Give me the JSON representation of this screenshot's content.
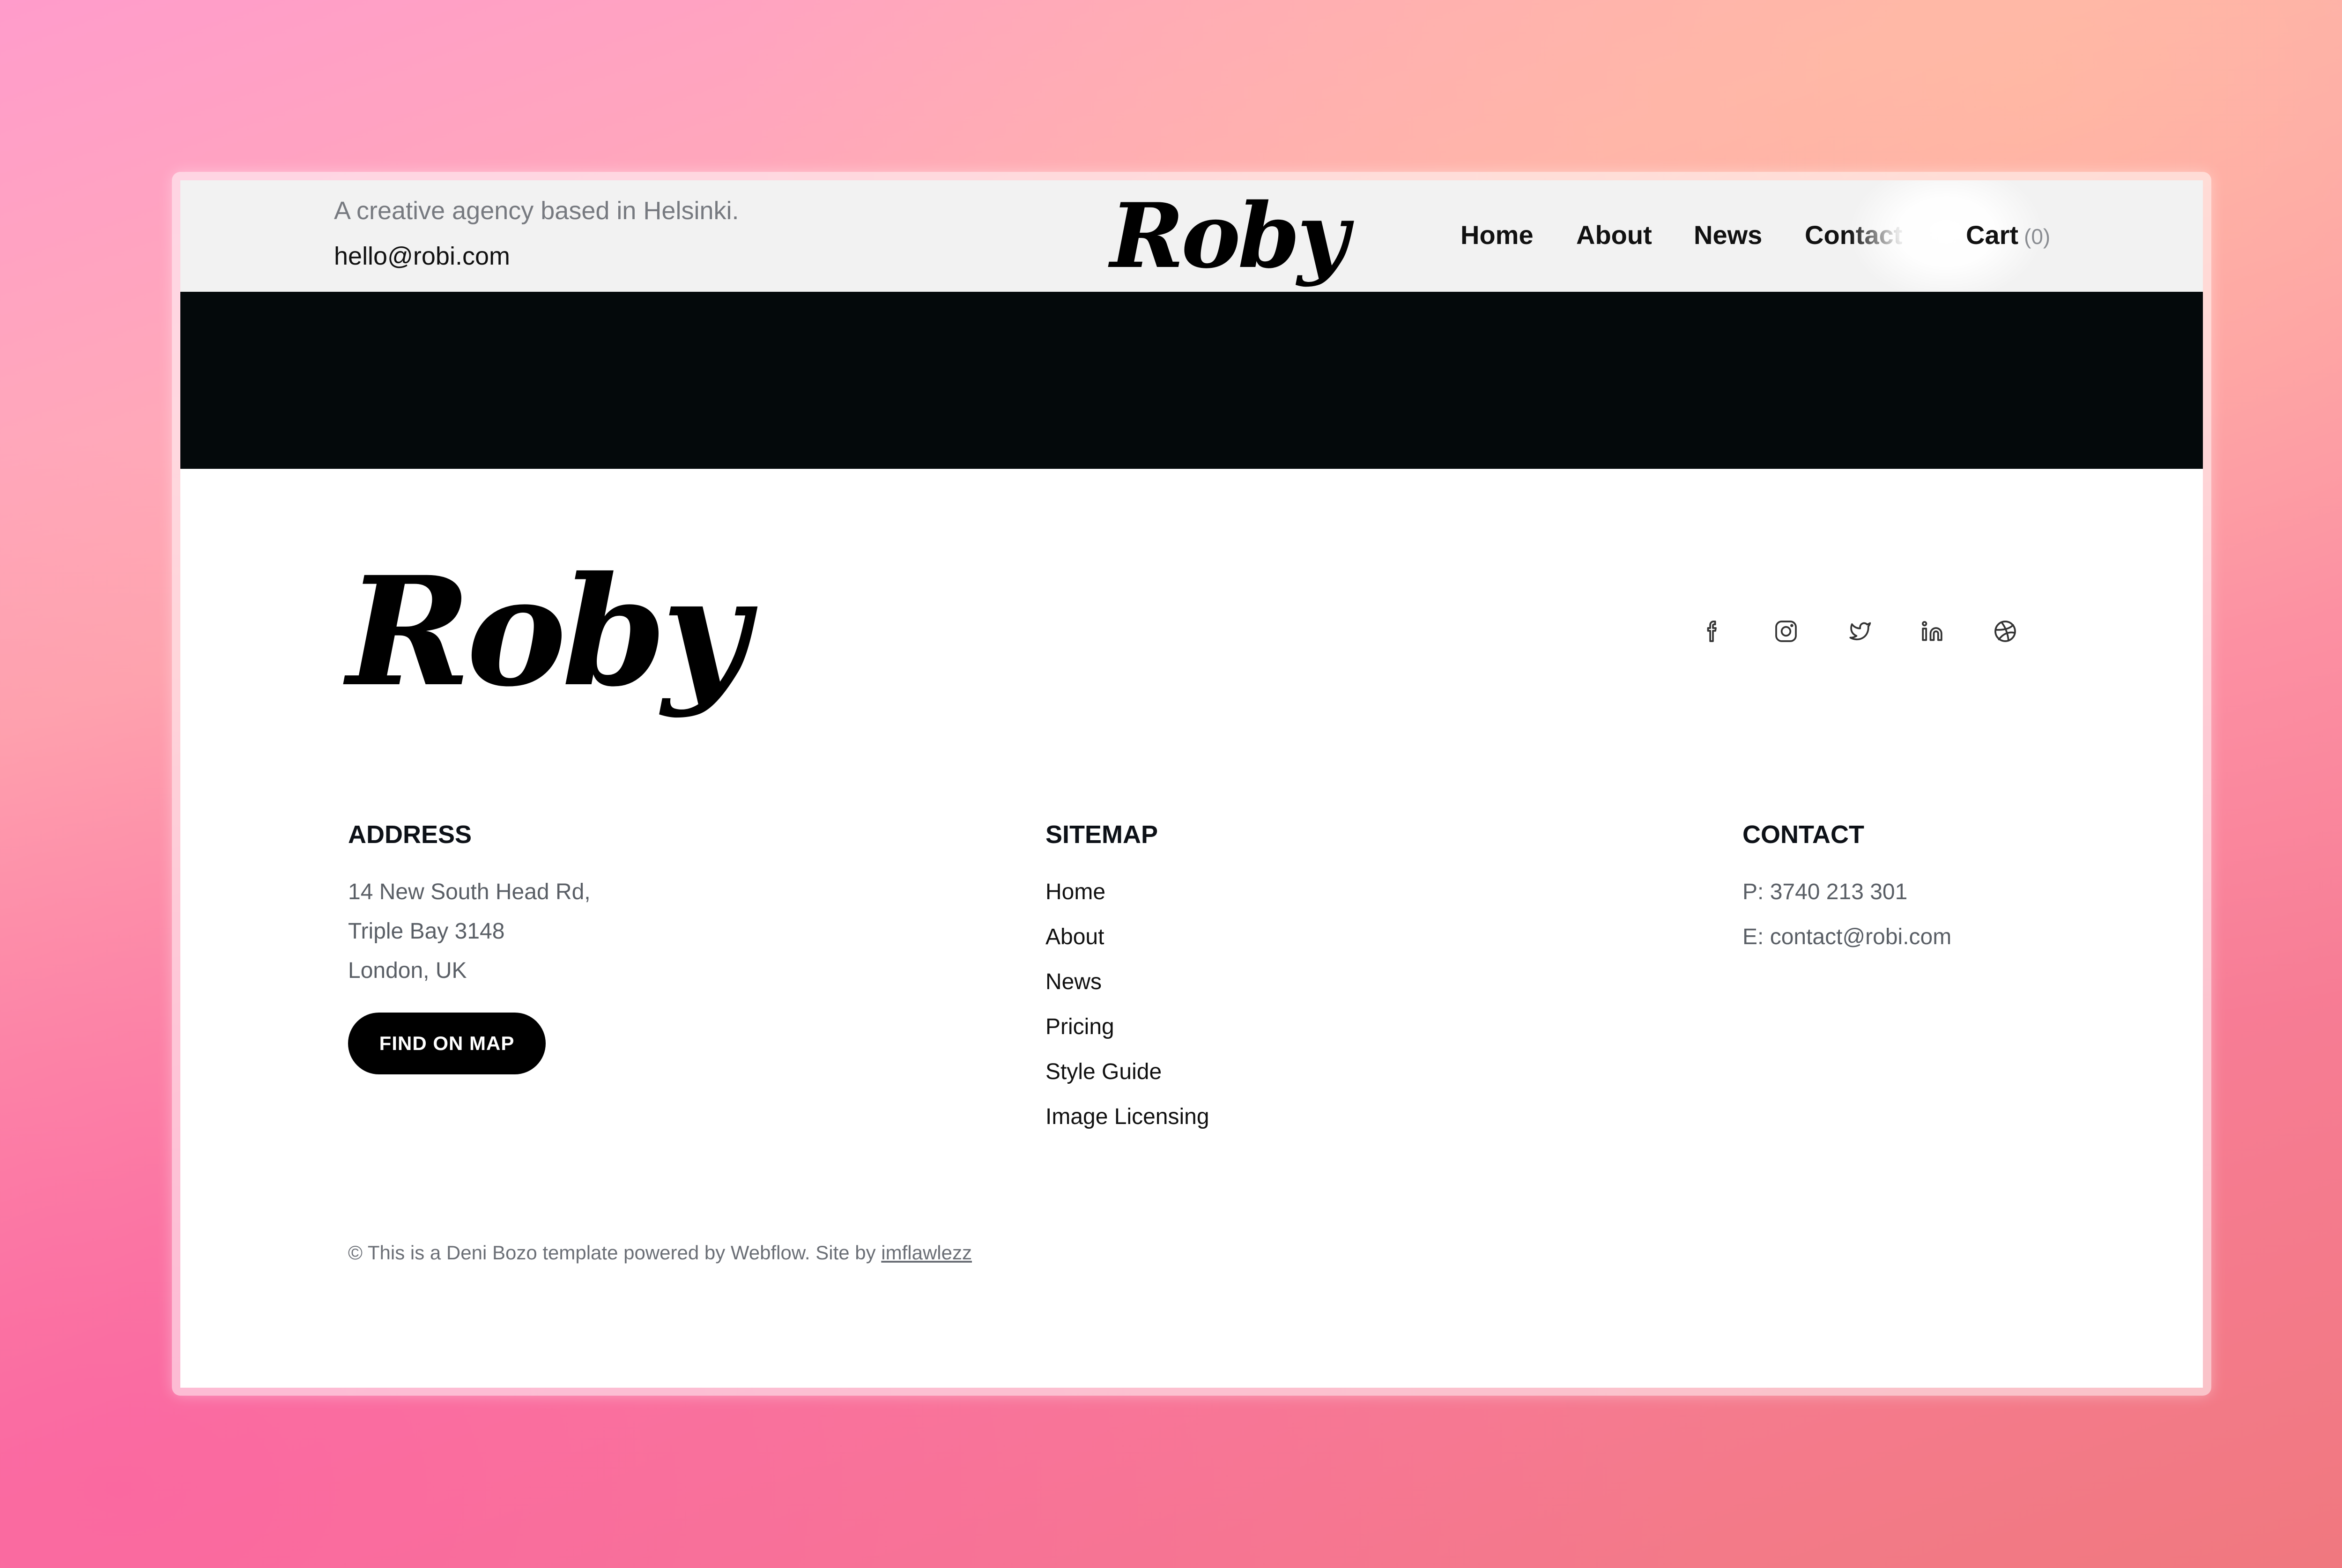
{
  "header": {
    "tagline": "A creative agency based in Helsinki.",
    "email": "hello@robi.com",
    "logo": "Roby",
    "nav": [
      "Home",
      "About",
      "News",
      "Contact"
    ],
    "cart_label": "Cart",
    "cart_count": "(0)"
  },
  "footer": {
    "logo": "Roby",
    "social_icons": [
      "facebook-icon",
      "instagram-icon",
      "twitter-icon",
      "linkedin-icon",
      "dribbble-icon"
    ],
    "address": {
      "title": "ADDRESS",
      "lines": [
        "14 New South Head Rd,",
        "Triple Bay 3148",
        "London, UK"
      ],
      "button": "FIND ON MAP"
    },
    "sitemap": {
      "title": "SITEMAP",
      "links": [
        "Home",
        "About",
        "News",
        "Pricing",
        "Style Guide",
        "Image Licensing"
      ]
    },
    "contact": {
      "title": "CONTACT",
      "phone": "P: 3740 213 301",
      "email": "E: contact@robi.com"
    },
    "copyright_text": "© This is a Deni Bozo template powered by Webflow. Site by ",
    "copyright_link": "imflawlezz"
  },
  "colors": {
    "banner": "#04090b",
    "header_bg": "#f2f2f2",
    "button_bg": "#000000"
  }
}
